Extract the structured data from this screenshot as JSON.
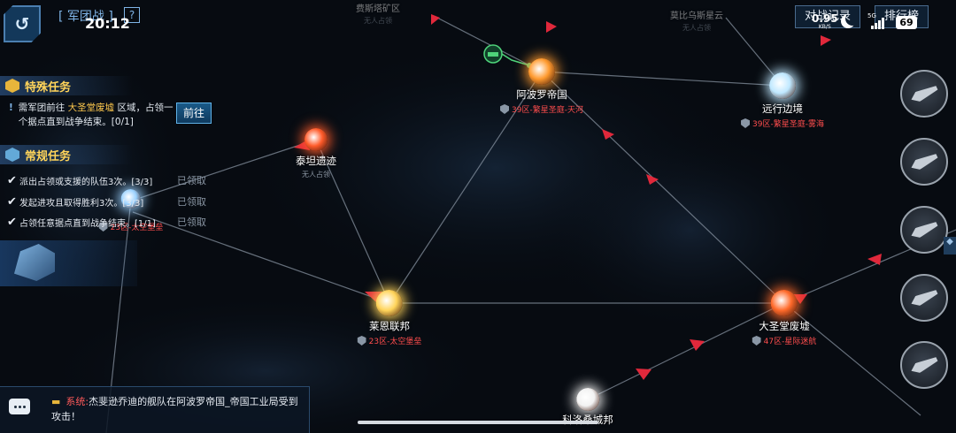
{
  "header": {
    "back_glyph": "↺",
    "legion_title": "[ 军团战 ]",
    "help_glyph": "?",
    "battle_record_label": "对战记录",
    "leaderboard_label": "排行榜"
  },
  "status_bar": {
    "time": "20:12",
    "net_speed": "0.95",
    "net_unit": "KB/S",
    "sim_tag": "5G",
    "battery": "69"
  },
  "tasks": {
    "special_title": "特殊任务",
    "special_text_pre": "需军团前往",
    "special_area": "大圣堂废墟",
    "special_text_post": "区域，占领一个据点直到战争结束。[0/1]",
    "go_label": "前往",
    "routine_title": "常规任务",
    "routine": [
      {
        "text": "派出占领或支援的队伍3次。[3/3]",
        "status": "已领取"
      },
      {
        "text": "发起进攻且取得胜利3次。[3/3]",
        "status": "已领取"
      },
      {
        "text": "占领任意据点直到战争结束。[1/1]",
        "status": "已领取"
      }
    ]
  },
  "map": {
    "nodes": [
      {
        "id": "apollo",
        "name": "阿波罗帝国",
        "owner": "39区-繁星圣庭-天河",
        "color": "#ff9a2e"
      },
      {
        "id": "frontier",
        "name": "远行边境",
        "owner": "39区-繁星圣庭-雾海",
        "color": "#bfe8ff"
      },
      {
        "id": "titan",
        "name": "泰坦遗迹",
        "sub": "无人占领",
        "color": "#ff5b2a"
      },
      {
        "id": "lane",
        "name": "莱恩联邦",
        "owner": "23区-太空堡垒",
        "color": "#ffd45a"
      },
      {
        "id": "cathedral",
        "name": "大圣堂废墟",
        "owner": "47区-星际迷航",
        "color": "#ff6a2a"
      },
      {
        "id": "keloson",
        "name": "科洛桑城邦",
        "color": "#f2f2f2"
      },
      {
        "id": "feisi",
        "name": "费斯塔矿区",
        "sub": "无人占领",
        "color": "#888888"
      },
      {
        "id": "mobius",
        "name": "莫比乌斯星云",
        "sub": "无人占领",
        "color": "#888888"
      },
      {
        "id": "hidden",
        "owner": "23区-太空堡垒",
        "color": "#9bd2ff"
      }
    ]
  },
  "fleet_buttons": [
    "ship-1",
    "ship-2",
    "ship-3",
    "ship-4",
    "ship-5"
  ],
  "chat": {
    "system_label": "系统:",
    "message": "杰斐逊乔迪的舰队在阿波罗帝国_帝国工业局受到攻击！"
  }
}
